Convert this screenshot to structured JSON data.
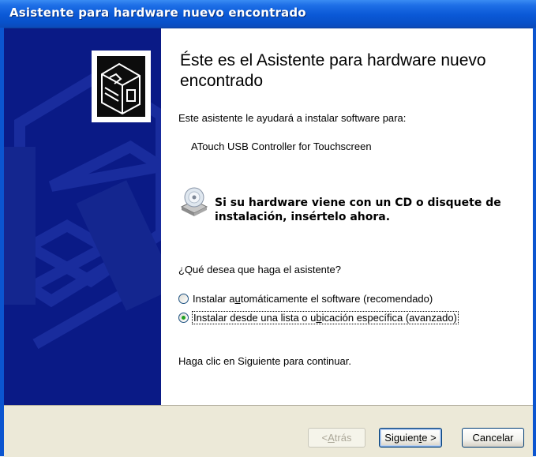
{
  "window": {
    "title": "Asistente para hardware nuevo encontrado"
  },
  "content": {
    "heading": "Éste es el Asistente para hardware nuevo encontrado",
    "intro": "Este asistente le ayudará a instalar software para:",
    "device": "ATouch USB Controller for Touchscreen",
    "cd_note": "Si su hardware viene con un CD o disquete de instalación, insértelo ahora.",
    "question": "¿Qué desea que haga el asistente?",
    "options": [
      {
        "label_pre": "Instalar a",
        "label_u": "u",
        "label_post": "tomáticamente el software (recomendado)",
        "checked": false
      },
      {
        "label_pre": "Instalar desde una lista o u",
        "label_u": "b",
        "label_post": "icación específica (avanzado)",
        "checked": true
      }
    ],
    "continue_note": "Haga clic en Siguiente para continuar."
  },
  "buttons": {
    "back": {
      "pre": "< ",
      "u": "A",
      "post": "trás"
    },
    "next": {
      "pre": "Siguien",
      "u": "t",
      "post": "e >"
    },
    "cancel": "Cancelar"
  },
  "colors": {
    "title_bar": "#0a58d6",
    "sidebar": "#0a1a86",
    "button_bar": "#ece9d8"
  }
}
